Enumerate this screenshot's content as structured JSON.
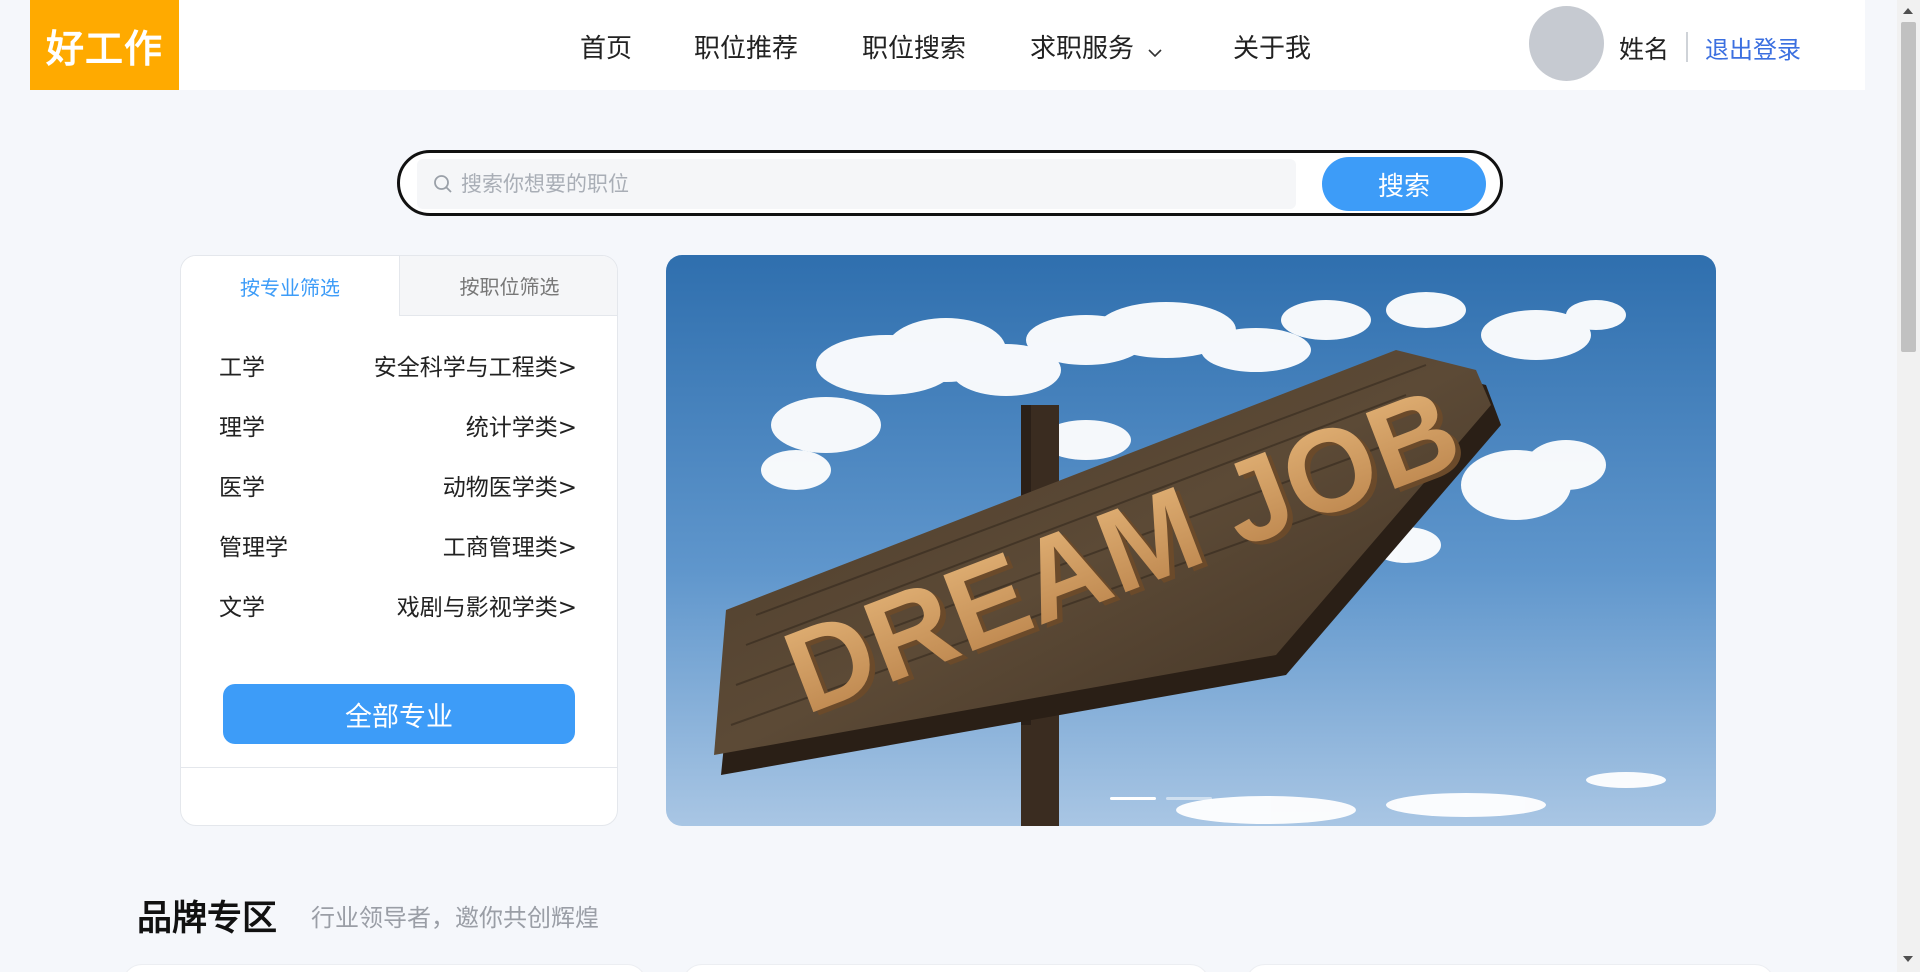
{
  "header": {
    "logo": "好工作",
    "nav": [
      "首页",
      "职位推荐",
      "职位搜索",
      "求职服务",
      "关于我"
    ],
    "user_name": "姓名",
    "logout": "退出登录"
  },
  "search": {
    "placeholder": "搜索你想要的职位",
    "button": "搜索"
  },
  "filter": {
    "tabs": [
      "按专业筛选",
      "按职位筛选"
    ],
    "active_tab": "按专业筛选",
    "rows": [
      {
        "category": "工学",
        "sub": "安全科学与工程类>"
      },
      {
        "category": "理学",
        "sub": "统计学类>"
      },
      {
        "category": "医学",
        "sub": "动物医学类>"
      },
      {
        "category": "管理学",
        "sub": "工商管理类>"
      },
      {
        "category": "文学",
        "sub": "戏剧与影视学类>"
      }
    ],
    "all_button": "全部专业"
  },
  "banner": {
    "sign_text": "DREAM JOB",
    "slides": 2,
    "active_slide": 1
  },
  "brand": {
    "title": "品牌专区",
    "subtitle": "行业领导者，邀你共创辉煌"
  },
  "colors": {
    "logo_bg": "#ffaa00",
    "accent": "#3d9cf8",
    "link": "#3b6fe0"
  }
}
